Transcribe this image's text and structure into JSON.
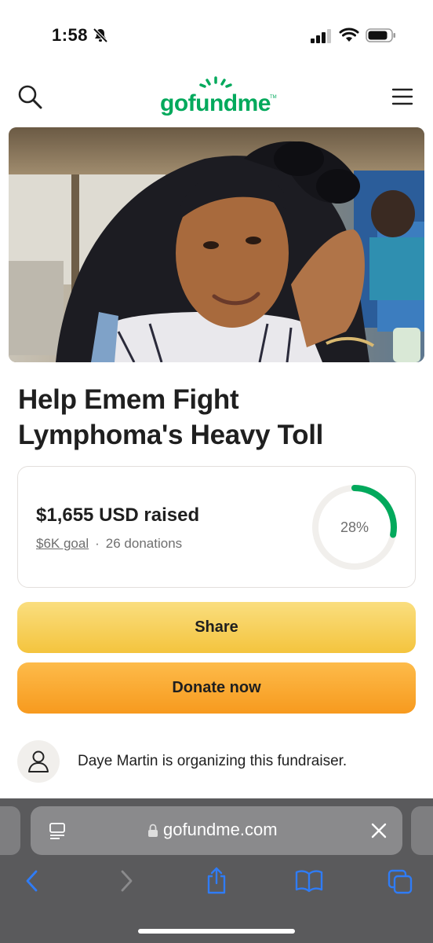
{
  "status_bar": {
    "time": "1:58",
    "icons": [
      "bell-slash-icon",
      "signal-icon",
      "wifi-icon",
      "battery-icon"
    ]
  },
  "header": {
    "logo_text": "gofundme",
    "logo_tm": "TM",
    "icons": [
      "search-icon",
      "hamburger-menu-icon"
    ],
    "brand_color": "#02a95c"
  },
  "campaign": {
    "title": "Help Emem Fight Lymphoma's Heavy Toll"
  },
  "progress": {
    "raised": "$1,655 USD raised",
    "goal": "$6K goal",
    "separator": "·",
    "donations": "26 donations",
    "percent_label": "28%",
    "percent_value": 28,
    "ring_color": "#02a95c",
    "track_color": "#f1efec"
  },
  "actions": {
    "share_label": "Share",
    "donate_label": "Donate now"
  },
  "organizer": {
    "text": "Daye Martin is organizing this fundraiser.",
    "icon": "person-icon"
  },
  "browser": {
    "url": "gofundme.com",
    "icons": [
      "page-menu-icon",
      "lock-icon",
      "clear-icon",
      "back-icon",
      "forward-icon",
      "share-icon",
      "bookmarks-icon",
      "tabs-icon"
    ],
    "accent": "#2f7cf6"
  }
}
